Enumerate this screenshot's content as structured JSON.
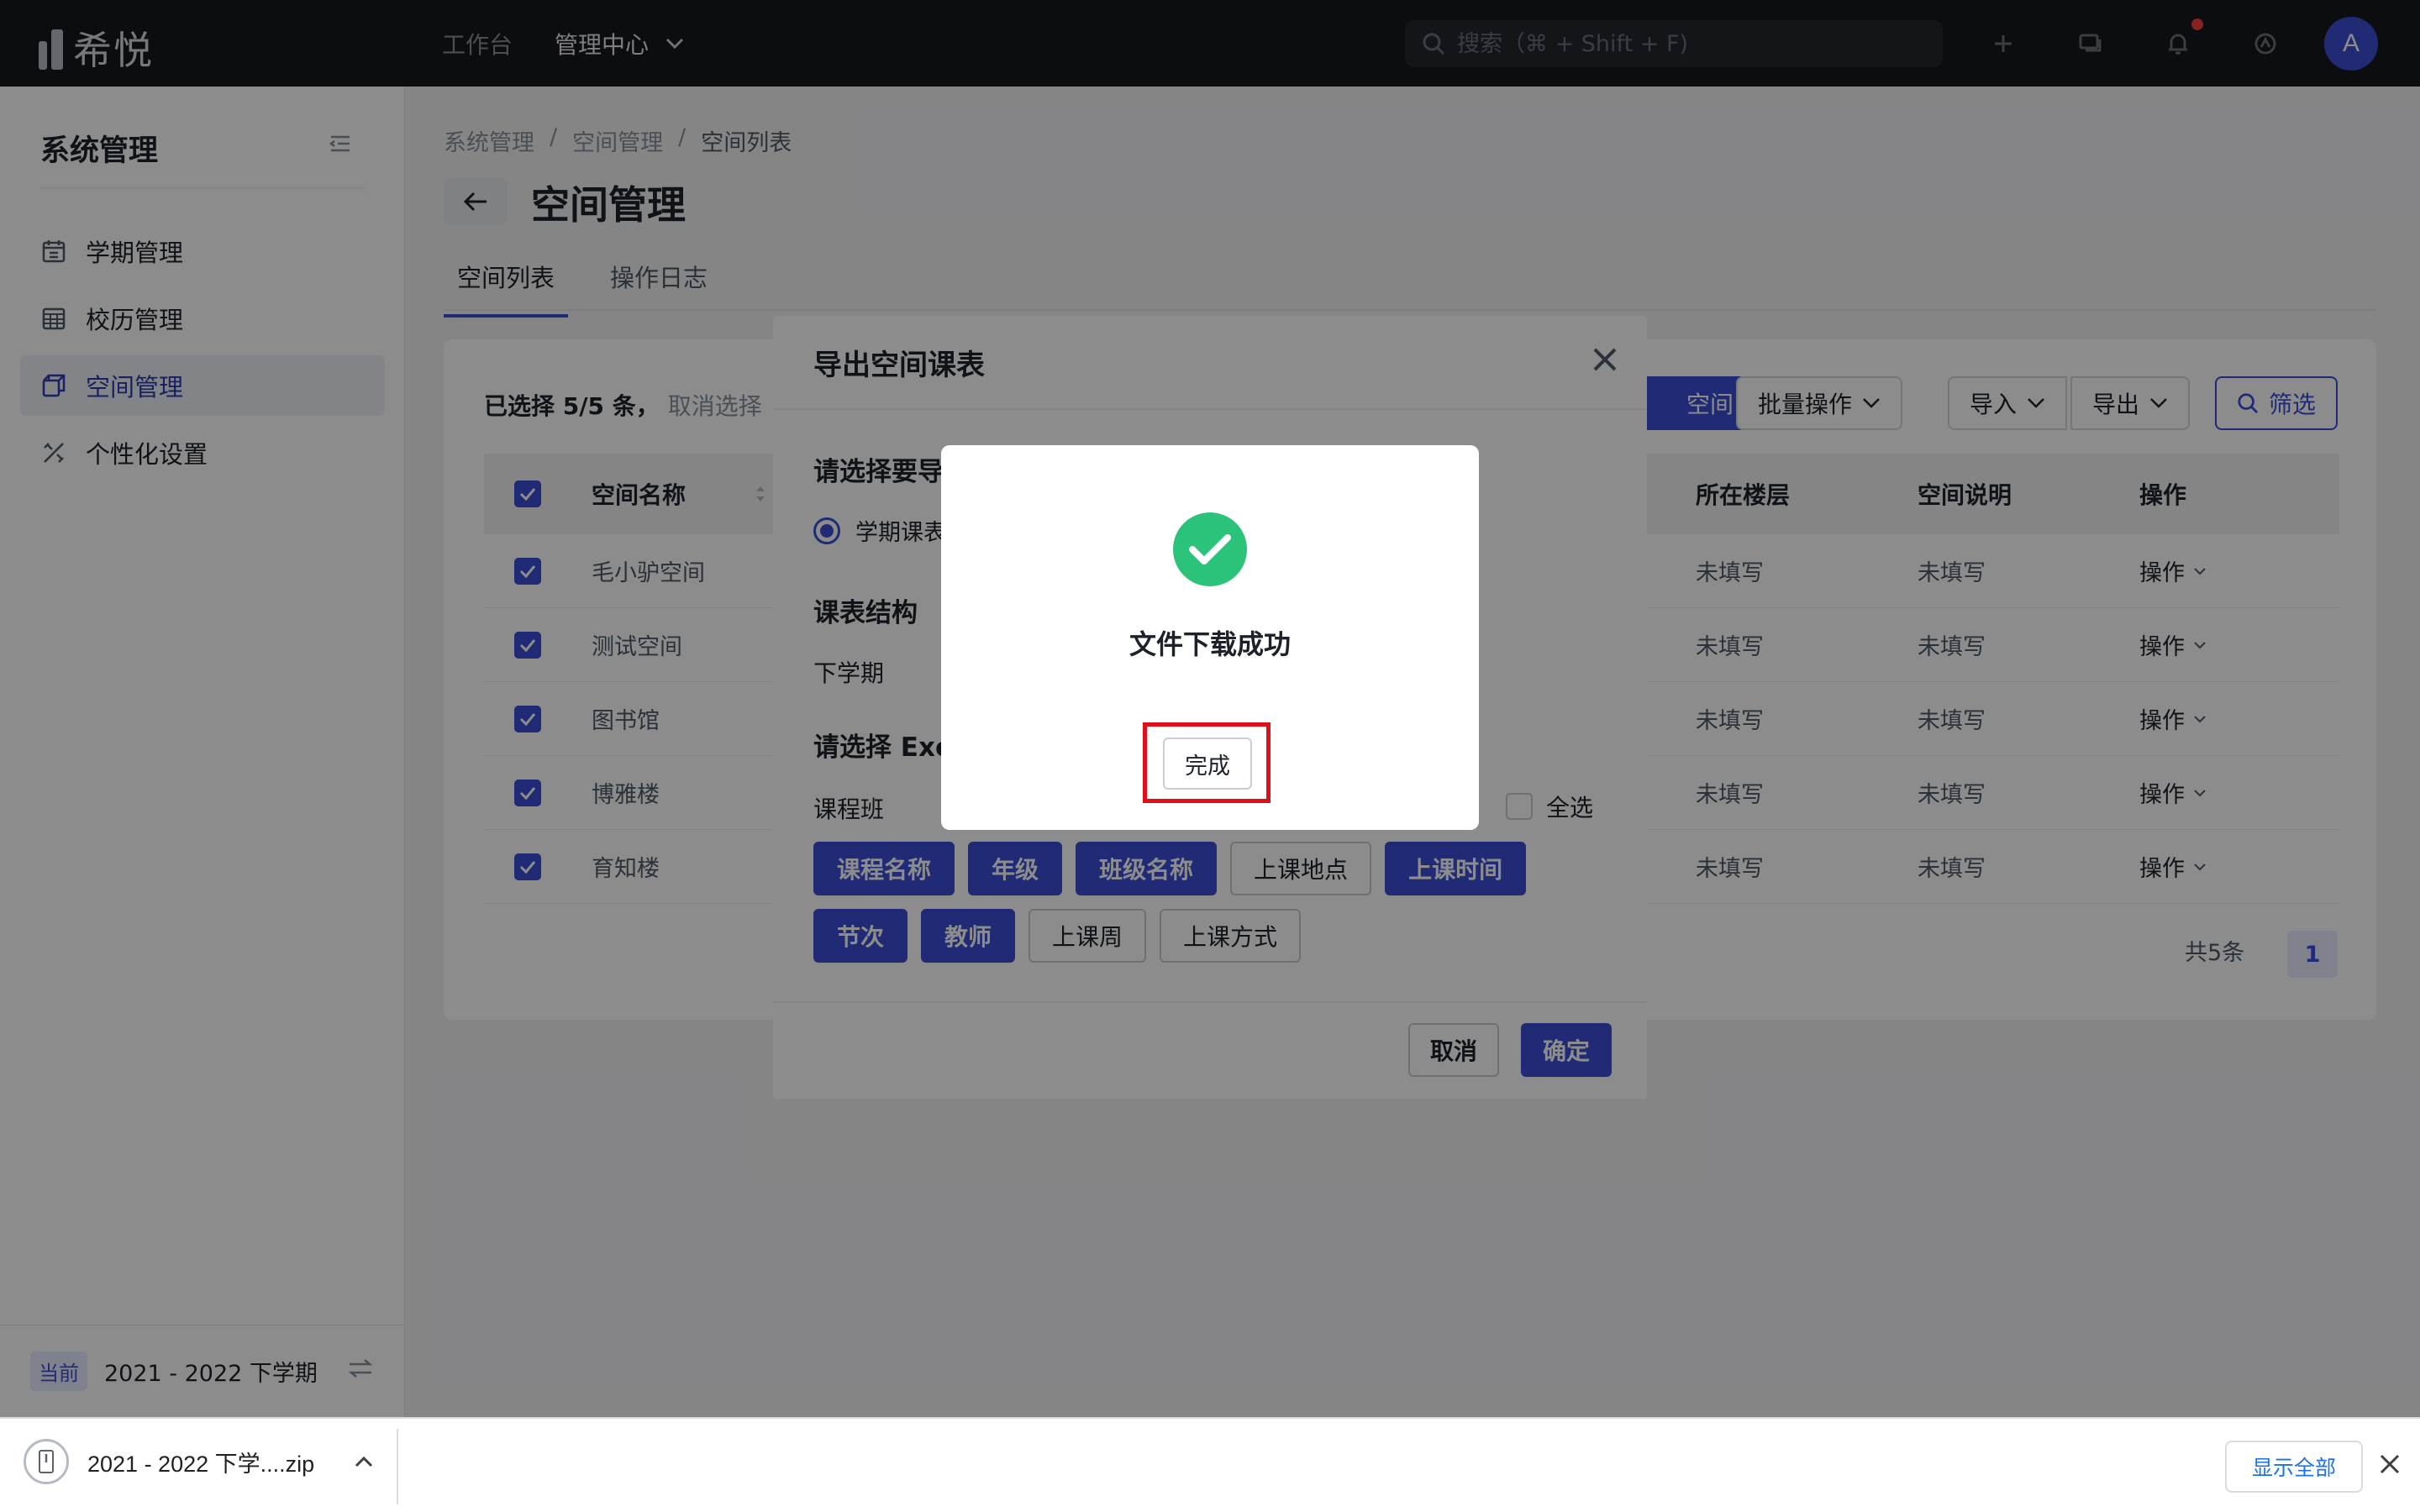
{
  "app": {
    "logo_text": "希悦"
  },
  "topnav": {
    "workbench": "工作台",
    "admin_center": "管理中心"
  },
  "search": {
    "placeholder": "搜索（⌘ + Shift + F)"
  },
  "user": {
    "avatar_letter": "A"
  },
  "sidebar": {
    "title": "系统管理",
    "items": [
      {
        "label": "学期管理",
        "icon": "calendar-icon"
      },
      {
        "label": "校历管理",
        "icon": "calendar-grid-icon"
      },
      {
        "label": "空间管理",
        "icon": "cube-icon"
      },
      {
        "label": "个性化设置",
        "icon": "tools-icon"
      }
    ],
    "current_tag": "当前",
    "current_term": "2021 - 2022 下学期"
  },
  "breadcrumb": [
    "系统管理",
    "/",
    "空间管理",
    "/",
    "空间列表"
  ],
  "page": {
    "title": "空间管理"
  },
  "tabs": [
    "空间列表",
    "操作日志"
  ],
  "selection": {
    "info": "已选择 5/5 条，",
    "cancel": "取消选择"
  },
  "toolbar": {
    "add_partial": "空间",
    "batch": "批量操作",
    "import": "导入",
    "export": "导出",
    "filter": "筛选"
  },
  "table": {
    "headers": {
      "name": "空间名称",
      "floor": "所在楼层",
      "desc": "空间说明",
      "ops": "操作"
    },
    "rows": [
      {
        "name": "毛小驴空间",
        "floor": "未填写",
        "desc": "未填写",
        "ops": "操作"
      },
      {
        "name": "测试空间",
        "floor": "未填写",
        "desc": "未填写",
        "ops": "操作"
      },
      {
        "name": "图书馆",
        "floor": "未填写",
        "desc": "未填写",
        "ops": "操作"
      },
      {
        "name": "博雅楼",
        "floor": "未填写",
        "desc": "未填写",
        "ops": "操作"
      },
      {
        "name": "育知楼",
        "floor": "未填写",
        "desc": "未填写",
        "ops": "操作"
      }
    ]
  },
  "pagination": {
    "total": "共5条",
    "page": "1"
  },
  "export_dialog": {
    "title": "导出空间课表",
    "section_type": "请选择要导",
    "radio_label": "学期课表",
    "section_structure": "课表结构",
    "structure_value": "下学期",
    "section_excel": "请选择 Exc",
    "row_label": "课程班",
    "select_all": "全选",
    "chips_row1": [
      {
        "label": "课程名称",
        "on": true
      },
      {
        "label": "年级",
        "on": true
      },
      {
        "label": "班级名称",
        "on": true
      },
      {
        "label": "上课地点",
        "on": false
      },
      {
        "label": "上课时间",
        "on": true
      }
    ],
    "chips_row2": [
      {
        "label": "节次",
        "on": true
      },
      {
        "label": "教师",
        "on": true
      },
      {
        "label": "上课周",
        "on": false
      },
      {
        "label": "上课方式",
        "on": false
      }
    ],
    "cancel": "取消",
    "ok": "确定"
  },
  "success_modal": {
    "message": "文件下载成功",
    "done": "完成"
  },
  "download_bar": {
    "filename": "2021 - 2022 下学....zip",
    "show_all": "显示全部"
  },
  "colors": {
    "primary": "#3c4ed6",
    "success": "#2bc27a",
    "highlight": "#e0101b",
    "topbar": "#17181c"
  }
}
